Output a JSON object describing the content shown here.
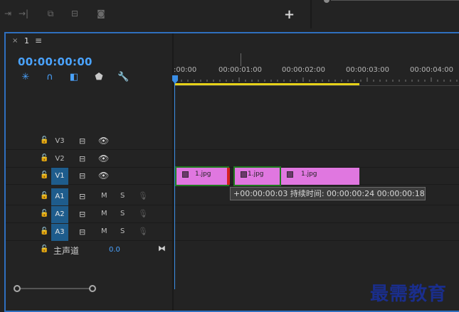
{
  "top_toolbar": {
    "icons": [
      "step-forward-icon",
      "insert-icon",
      "overwrite-icon",
      "camera-icon"
    ],
    "add_label": "+"
  },
  "timeline": {
    "tab_close": "×",
    "tab_name": "1",
    "tab_menu": "≡",
    "timecode": "00:00:00:00",
    "tools": [
      "snap-icon",
      "linked-selection-icon",
      "add-marker-icon",
      "marker-icon",
      "wrench-icon"
    ],
    "ruler_labels": [
      ":00:00",
      "00:00:01:00",
      "00:00:02:00",
      "00:00:03:00",
      "00:00:04:00"
    ],
    "video_tracks": [
      {
        "name": "V3"
      },
      {
        "name": "V2"
      },
      {
        "name": "V1"
      }
    ],
    "audio_tracks": [
      {
        "name": "A1",
        "m": "M",
        "s": "S"
      },
      {
        "name": "A2",
        "m": "M",
        "s": "S"
      },
      {
        "name": "A3",
        "m": "M",
        "s": "S"
      }
    ],
    "master": {
      "name": "主声道",
      "value": "0.0"
    },
    "clips": [
      {
        "name": "1.jpg"
      },
      {
        "name": "1.jpg"
      },
      {
        "name": "1.jpg"
      }
    ],
    "tooltip": "+00:00:00:03 持续时间: 00:00:00:24 00:00:00:18"
  },
  "watermark": "最需教育",
  "colors": {
    "accent": "#4aa3ff",
    "clip": "#e077e0",
    "work_area": "#e6d219",
    "track_active": "#1e5c8c"
  }
}
